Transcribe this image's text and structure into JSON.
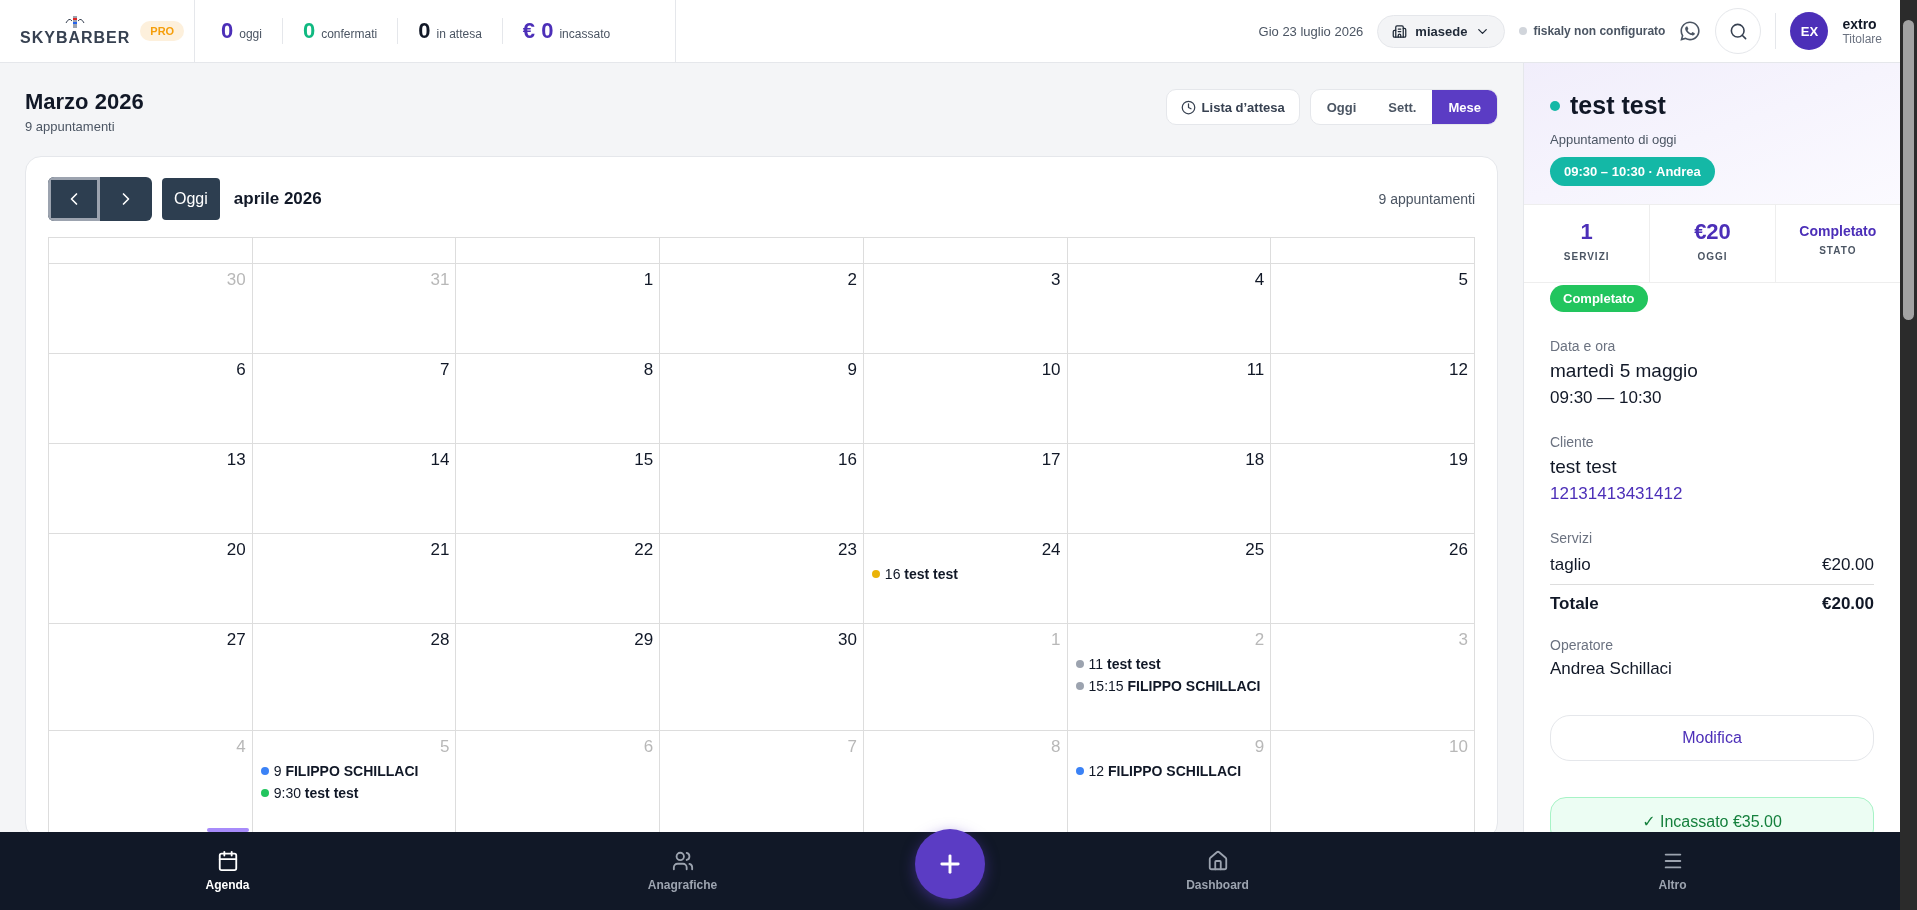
{
  "brand": {
    "name": "SKYBARBER",
    "plan": "PRO"
  },
  "stats": [
    {
      "value": "0",
      "label": "oggi",
      "color": "#4c2fb8"
    },
    {
      "value": "0",
      "label": "confermati",
      "color": "#10b981"
    },
    {
      "value": "0",
      "label": "in attesa",
      "color": "#111827"
    },
    {
      "value": "€ 0",
      "label": "incassato",
      "color": "#4c2fb8"
    }
  ],
  "header": {
    "date": "Gio 23 luglio 2026",
    "branch": "miasede",
    "fiscal_status": "fiskaly non configurato",
    "user": {
      "initials": "EX",
      "name": "extro",
      "role": "Titolare"
    }
  },
  "page": {
    "title": "Marzo 2026",
    "subtitle": "9 appuntamenti",
    "waitlist": "Lista d’attesa",
    "views": [
      {
        "label": "Oggi",
        "selected": false
      },
      {
        "label": "Sett.",
        "selected": false
      },
      {
        "label": "Mese",
        "selected": true
      }
    ]
  },
  "calendar": {
    "today_button": "Oggi",
    "month": "aprile 2026",
    "count": "9 appuntamenti",
    "weeks": [
      [
        {
          "day": "30",
          "muted": true
        },
        {
          "day": "31",
          "muted": true
        },
        {
          "day": "1",
          "muted": false
        },
        {
          "day": "2",
          "muted": false
        },
        {
          "day": "3",
          "muted": false
        },
        {
          "day": "4",
          "muted": false
        },
        {
          "day": "5",
          "muted": false
        }
      ],
      [
        {
          "day": "6",
          "muted": false
        },
        {
          "day": "7",
          "muted": false
        },
        {
          "day": "8",
          "muted": false
        },
        {
          "day": "9",
          "muted": false
        },
        {
          "day": "10",
          "muted": false
        },
        {
          "day": "11",
          "muted": false
        },
        {
          "day": "12",
          "muted": false
        }
      ],
      [
        {
          "day": "13",
          "muted": false
        },
        {
          "day": "14",
          "muted": false
        },
        {
          "day": "15",
          "muted": false
        },
        {
          "day": "16",
          "muted": false
        },
        {
          "day": "17",
          "muted": false
        },
        {
          "day": "18",
          "muted": false
        },
        {
          "day": "19",
          "muted": false
        }
      ],
      [
        {
          "day": "20",
          "muted": false
        },
        {
          "day": "21",
          "muted": false
        },
        {
          "day": "22",
          "muted": false
        },
        {
          "day": "23",
          "muted": false
        },
        {
          "day": "24",
          "muted": false,
          "events": [
            {
              "text": "16 **test test**",
              "color": "#eab308"
            }
          ]
        },
        {
          "day": "25",
          "muted": false
        },
        {
          "day": "26",
          "muted": false
        }
      ],
      [
        {
          "day": "27",
          "muted": false
        },
        {
          "day": "28",
          "muted": false
        },
        {
          "day": "29",
          "muted": false
        },
        {
          "day": "30",
          "muted": false
        },
        {
          "day": "1",
          "muted": true
        },
        {
          "day": "2",
          "muted": true,
          "events": [
            {
              "text": "11 **test test**",
              "color": "#9ca3af"
            },
            {
              "text": "15:15 **FILIPPO SCHILLACI**",
              "color": "#9ca3af"
            }
          ]
        },
        {
          "day": "3",
          "muted": true
        }
      ],
      [
        {
          "day": "4",
          "muted": true
        },
        {
          "day": "5",
          "muted": true,
          "events": [
            {
              "text": "9 **FILIPPO SCHILLACI**",
              "color": "#3b82f6"
            },
            {
              "text": "9:30 **test test**",
              "color": "#22c55e"
            }
          ]
        },
        {
          "day": "6",
          "muted": true
        },
        {
          "day": "7",
          "muted": true
        },
        {
          "day": "8",
          "muted": true
        },
        {
          "day": "9",
          "muted": true,
          "events": [
            {
              "text": "12 **FILIPPO SCHILLACI**",
              "color": "#3b82f6"
            }
          ]
        },
        {
          "day": "10",
          "muted": true
        }
      ]
    ]
  },
  "detail": {
    "title": "test test",
    "subtitle": "Appuntamento di oggi",
    "time_badge": "09:30 – 10:30 · Andrea",
    "stats": [
      {
        "value": "1",
        "label": "SERVIZI"
      },
      {
        "value": "€20",
        "label": "OGGI"
      },
      {
        "value": "Completato",
        "label": "STATO"
      }
    ],
    "status": "Completato",
    "date_label": "Data e ora",
    "date": "martedì 5 maggio",
    "time": "09:30 — 10:30",
    "client_label": "Cliente",
    "client": "test test",
    "phone": "12131413431412",
    "services_label": "Servizi",
    "services": [
      {
        "name": "taglio",
        "price": "€20.00"
      }
    ],
    "total_label": "Totale",
    "total": "€20.00",
    "operator_label": "Operatore",
    "operator": "Andrea Schillaci",
    "edit_button": "Modifica",
    "paid_button": "✓ Incassato €35.00"
  },
  "nav": [
    {
      "kind": "tab",
      "label": "Agenda",
      "selected": true
    },
    {
      "kind": "tab",
      "label": "Anagrafiche",
      "selected": false
    },
    {
      "kind": "add"
    },
    {
      "kind": "tab",
      "label": "Dashboard",
      "selected": false
    },
    {
      "kind": "tab",
      "label": "Altro",
      "selected": false
    }
  ]
}
